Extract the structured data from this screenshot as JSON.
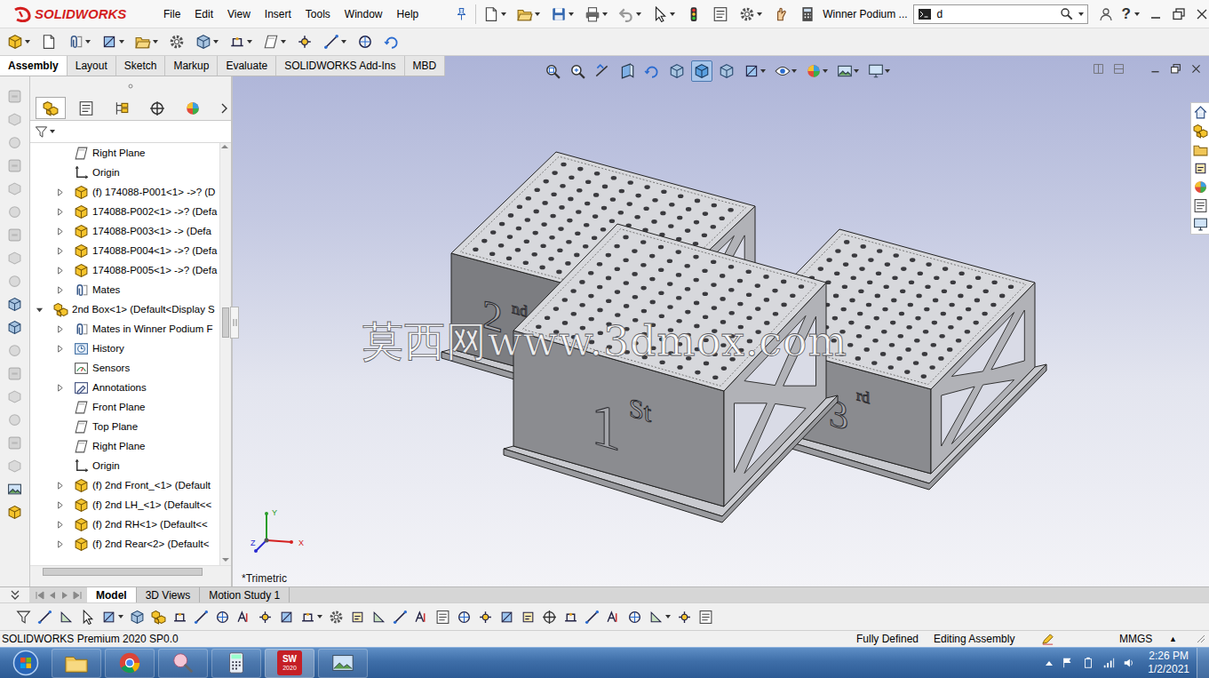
{
  "app": {
    "brand": "SOLIDWORKS"
  },
  "menu": [
    "File",
    "Edit",
    "View",
    "Insert",
    "Tools",
    "Window",
    "Help"
  ],
  "window": {
    "title": "Winner Podium ..."
  },
  "search": {
    "value": "d"
  },
  "titlebar": {
    "help": "?"
  },
  "command_tabs": [
    {
      "label": "Assembly",
      "selected": true
    },
    {
      "label": "Layout",
      "selected": false
    },
    {
      "label": "Sketch",
      "selected": false
    },
    {
      "label": "Markup",
      "selected": false
    },
    {
      "label": "Evaluate",
      "selected": false
    },
    {
      "label": "SOLIDWORKS Add-Ins",
      "selected": false
    },
    {
      "label": "MBD",
      "selected": false
    }
  ],
  "panel_tabs": [
    {
      "selected": true
    },
    {
      "selected": false
    },
    {
      "selected": false
    },
    {
      "selected": false
    },
    {
      "selected": false
    }
  ],
  "tree": {
    "items": [
      {
        "label": "Right Plane",
        "kind": "plane",
        "depth": 1,
        "expandable": false,
        "expanded": false
      },
      {
        "label": "Origin",
        "kind": "origin",
        "depth": 1,
        "expandable": false,
        "expanded": false
      },
      {
        "label": "(f) 174088-P001<1> ->? (D",
        "kind": "part",
        "depth": 1,
        "expandable": true,
        "expanded": false
      },
      {
        "label": "174088-P002<1> ->? (Defa",
        "kind": "part",
        "depth": 1,
        "expandable": true,
        "expanded": false
      },
      {
        "label": "174088-P003<1> -> (Defa",
        "kind": "part",
        "depth": 1,
        "expandable": true,
        "expanded": false
      },
      {
        "label": "174088-P004<1> ->? (Defa",
        "kind": "part",
        "depth": 1,
        "expandable": true,
        "expanded": false
      },
      {
        "label": "174088-P005<1> ->? (Defa",
        "kind": "part",
        "depth": 1,
        "expandable": true,
        "expanded": false
      },
      {
        "label": "Mates",
        "kind": "mates",
        "depth": 1,
        "expandable": true,
        "expanded": false
      },
      {
        "label": "2nd Box<1> (Default<Display S",
        "kind": "assembly",
        "depth": 0,
        "expandable": true,
        "expanded": true
      },
      {
        "label": "Mates in Winner Podium F",
        "kind": "mates",
        "depth": 1,
        "expandable": true,
        "expanded": false
      },
      {
        "label": "History",
        "kind": "history",
        "depth": 1,
        "expandable": true,
        "expanded": false
      },
      {
        "label": "Sensors",
        "kind": "sensors",
        "depth": 1,
        "expandable": false,
        "expanded": false
      },
      {
        "label": "Annotations",
        "kind": "annotations",
        "depth": 1,
        "expandable": true,
        "expanded": false
      },
      {
        "label": "Front Plane",
        "kind": "plane",
        "depth": 1,
        "expandable": false,
        "expanded": false
      },
      {
        "label": "Top Plane",
        "kind": "plane",
        "depth": 1,
        "expandable": false,
        "expanded": false
      },
      {
        "label": "Right Plane",
        "kind": "plane",
        "depth": 1,
        "expandable": false,
        "expanded": false
      },
      {
        "label": "Origin",
        "kind": "origin",
        "depth": 1,
        "expandable": false,
        "expanded": false
      },
      {
        "label": "(f) 2nd Front_<1> (Default",
        "kind": "part",
        "depth": 1,
        "expandable": true,
        "expanded": false
      },
      {
        "label": "(f) 2nd LH_<1> (Default<<",
        "kind": "part",
        "depth": 1,
        "expandable": true,
        "expanded": false
      },
      {
        "label": "(f) 2nd RH<1> (Default<<",
        "kind": "part",
        "depth": 1,
        "expandable": true,
        "expanded": false
      },
      {
        "label": "(f) 2nd Rear<2> (Default<",
        "kind": "part",
        "depth": 1,
        "expandable": true,
        "expanded": false
      }
    ]
  },
  "view_tools": [
    {
      "selected": false
    },
    {
      "selected": false
    },
    {
      "selected": false
    },
    {
      "selected": false
    },
    {
      "selected": false
    },
    {
      "selected": false
    },
    {
      "selected": true
    },
    {
      "selected": false
    },
    {
      "selected": false
    },
    {
      "selected": false
    },
    {
      "selected": false
    },
    {
      "selected": false
    },
    {
      "selected": false
    }
  ],
  "viewport": {
    "view_name": "*Trimetric",
    "watermark": "莫西网www.3dmox.com",
    "model_labels": [
      {
        "text": "2"
      },
      {
        "text": "nd"
      },
      {
        "text": "1"
      },
      {
        "text": "St"
      },
      {
        "text": "3"
      },
      {
        "text": "rd"
      }
    ],
    "axes": [
      {
        "label": "Y",
        "color": "#2a9d2a"
      },
      {
        "label": "X",
        "color": "#d42020"
      },
      {
        "label": "Z",
        "color": "#2a2ad0"
      }
    ]
  },
  "bottom_tabs": [
    {
      "label": "Model",
      "selected": true
    },
    {
      "label": "3D Views",
      "selected": false
    },
    {
      "label": "Motion Study 1",
      "selected": false
    }
  ],
  "status_bar": {
    "product": "SOLIDWORKS Premium 2020 SP0.0",
    "sketch_state": "Fully Defined",
    "mode": "Editing Assembly",
    "units": "MMGS",
    "units_menu": "▲"
  },
  "taskbar": {
    "sw_badge": "SW",
    "sw_year": "2020",
    "time": "2:26 PM",
    "date": "1/2/2021"
  }
}
